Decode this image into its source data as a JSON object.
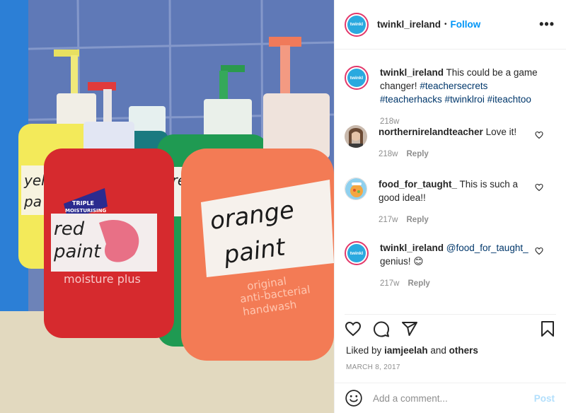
{
  "photo": {
    "bottles": [
      {
        "label": "yellow paint",
        "color": "#f3ea5a"
      },
      {
        "label": "red paint",
        "color": "#d62a2e",
        "brand": "TRIPLE MOISTURISING",
        "product": "moisture plus"
      },
      {
        "label": "green paint",
        "color": "#1f9a52"
      },
      {
        "label": "orange paint",
        "color": "#f37b55",
        "product": "original anti-bacterial handwash"
      }
    ]
  },
  "header": {
    "username": "twinkl_ireland",
    "dot": "•",
    "follow_label": "Follow",
    "more_label": "•••",
    "avatar_text": "twinkl"
  },
  "caption": {
    "username": "twinkl_ireland",
    "text": "This could be a game changer!",
    "hashtags": "#teachersecrets #teacherhacks #twinklroi #iteachtoo",
    "age": "218w"
  },
  "comments": [
    {
      "username": "northernirelandteacher",
      "text": "Love it!",
      "age": "218w",
      "reply_label": "Reply"
    },
    {
      "username": "food_for_taught_",
      "text": "This is such a good idea!!",
      "age": "217w",
      "reply_label": "Reply"
    },
    {
      "username": "twinkl_ireland",
      "mention": "@food_for_taught_",
      "text": "genius!",
      "emoji": "😊",
      "age": "217w",
      "reply_label": "Reply"
    }
  ],
  "likes": {
    "prefix": "Liked by",
    "user": "iamjeelah",
    "and": "and",
    "others": "others"
  },
  "date": "MARCH 8, 2017",
  "composer": {
    "placeholder": "Add a comment...",
    "post_label": "Post"
  },
  "colors": {
    "accent": "#0095f6",
    "link": "#00376b",
    "muted": "#8e8e8e",
    "post_disabled": "#b2dffc"
  }
}
